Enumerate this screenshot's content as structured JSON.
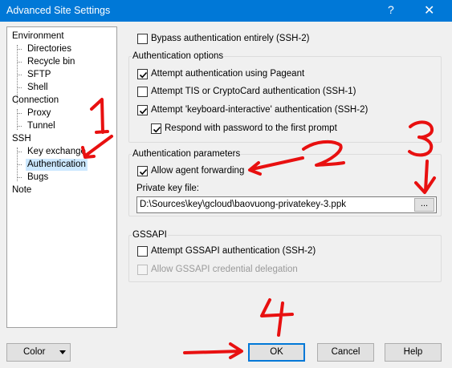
{
  "window": {
    "title": "Advanced Site Settings",
    "help_glyph": "?",
    "close_glyph": "✕"
  },
  "tree": {
    "environment": "Environment",
    "directories": "Directories",
    "recycle_bin": "Recycle bin",
    "sftp": "SFTP",
    "shell": "Shell",
    "connection": "Connection",
    "proxy": "Proxy",
    "tunnel": "Tunnel",
    "ssh": "SSH",
    "key_exchange": "Key exchange",
    "authentication": "Authentication",
    "bugs": "Bugs",
    "note": "Note",
    "selected": "Authentication"
  },
  "bypass": {
    "label": "Bypass authentication entirely (SSH-2)",
    "checked": false
  },
  "auth_options": {
    "title": "Authentication options",
    "pageant": {
      "label": "Attempt authentication using Pageant",
      "checked": true
    },
    "tis": {
      "label": "Attempt TIS or CryptoCard authentication (SSH-1)",
      "checked": false
    },
    "kbi": {
      "label": "Attempt 'keyboard-interactive' authentication (SSH-2)",
      "checked": true
    },
    "respond": {
      "label": "Respond with password to the first prompt",
      "checked": true
    }
  },
  "auth_params": {
    "title": "Authentication parameters",
    "agent_fwd": {
      "label": "Allow agent forwarding",
      "checked": true
    },
    "key_label": "Private key file:",
    "key_value": "D:\\Sources\\key\\gcloud\\baovuong-privatekey-3.ppk",
    "browse_label": "..."
  },
  "gssapi": {
    "title": "GSSAPI",
    "attempt": {
      "label": "Attempt GSSAPI authentication (SSH-2)",
      "checked": false
    },
    "delegation": {
      "label": "Allow GSSAPI credential delegation",
      "checked": false,
      "disabled": true
    }
  },
  "buttons": {
    "color": "Color",
    "ok": "OK",
    "cancel": "Cancel",
    "help": "Help"
  },
  "annotations": {
    "color": "#e81010",
    "marks": [
      "1",
      "2",
      "3",
      "4"
    ]
  },
  "colors": {
    "titlebar": "#0078d7",
    "selection": "#cce8ff",
    "default_button_border": "#0078d7"
  }
}
